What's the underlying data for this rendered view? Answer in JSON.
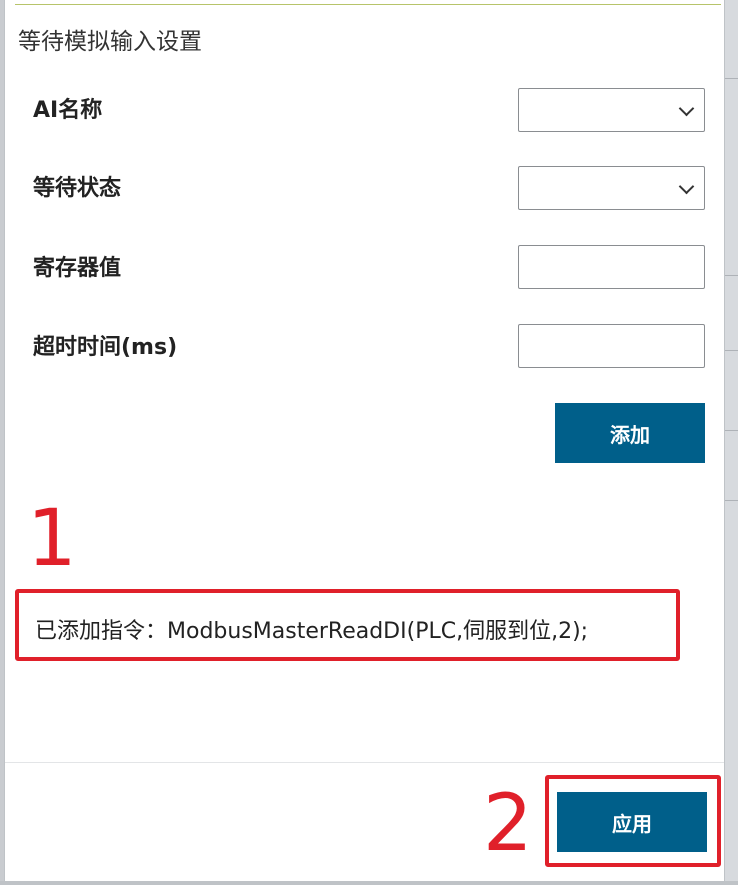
{
  "dialog": {
    "title": "等待模拟输入设置"
  },
  "fields": {
    "ai_name": {
      "label": "AI名称",
      "value": ""
    },
    "wait_state": {
      "label": "等待状态",
      "value": ""
    },
    "register_value": {
      "label": "寄存器值",
      "value": ""
    },
    "timeout": {
      "label": "超时时间(ms)",
      "value": ""
    }
  },
  "buttons": {
    "add_label": "添加",
    "apply_label": "应用"
  },
  "added_instruction": "已添加指令：ModbusMasterReadDI(PLC,伺服到位,2);",
  "annotations": {
    "one": "1",
    "two": "2"
  },
  "colors": {
    "accent": "#005f8a",
    "annotation_red": "#e0202a",
    "title_rule": "#b7c46a"
  },
  "icons": {
    "dropdown": "chevron-down-icon"
  }
}
